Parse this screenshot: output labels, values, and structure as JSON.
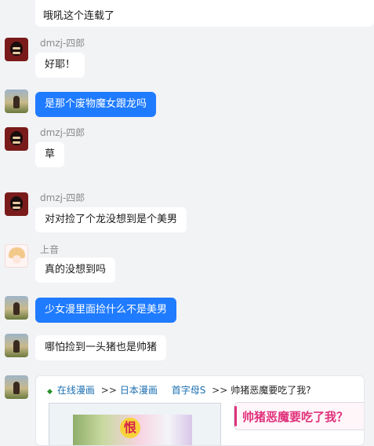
{
  "messages": [
    {
      "text": "哦吼这个连载了"
    },
    {
      "sender": "dmzj-四郎",
      "text": "好耶！"
    },
    {
      "text": "是那个废物魔女跟龙吗"
    },
    {
      "sender": "dmzj-四郎",
      "text": "草"
    },
    {
      "sender": "dmzj-四郎",
      "text": "对对捡了个龙没想到是个美男"
    },
    {
      "sender": "上音",
      "text": "真的没想到吗"
    },
    {
      "text": "少女漫里面捡什么不是美男"
    },
    {
      "text": "哪怕捡到一头猪也是帅猪"
    }
  ],
  "link_card": {
    "crumb_1": "在线漫画",
    "crumb_2": "日本漫画",
    "crumb_3": "首字母S",
    "crumb_current": "帅猪恶魔要吃了我?",
    "sep_1": ">>",
    "sep_2": ">>",
    "sep_3": ">>",
    "cover_badge": "恨",
    "title": "帅猪恶魔要吃了我？"
  },
  "colors": {
    "background": "#f2f3f5",
    "self_bubble": "#1f7bff",
    "other_bubble": "#ffffff",
    "title_accent": "#e0307a",
    "link": "#1c6fb0"
  }
}
